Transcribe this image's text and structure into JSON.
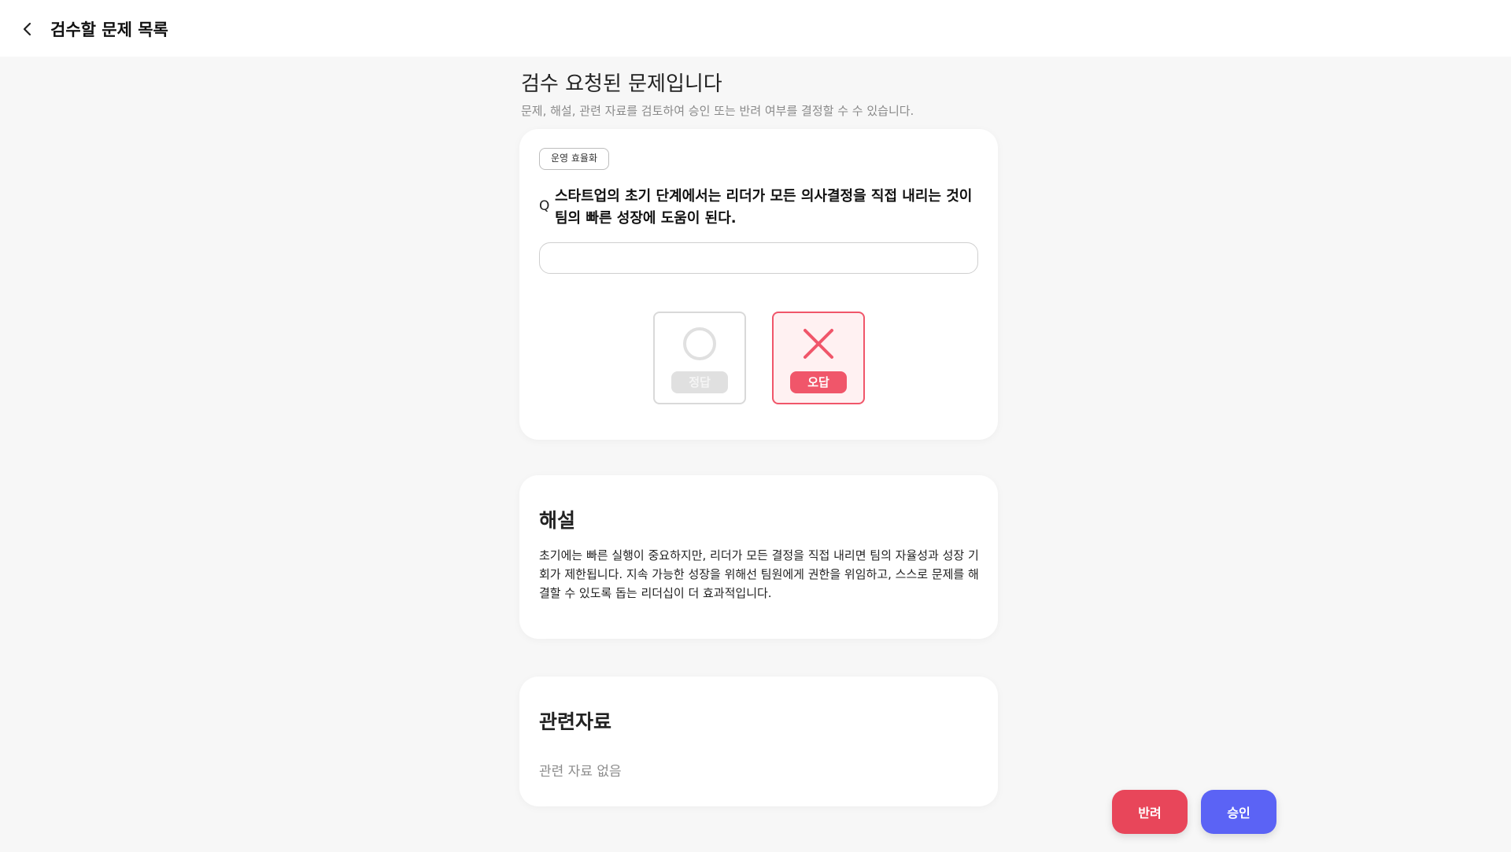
{
  "header": {
    "back_icon": "chevron-left-icon",
    "title": "검수할 문제 목록"
  },
  "page": {
    "heading": "검수 요청된 문제입니다",
    "subheading": "문제, 해설, 관련 자료를 검토하여 승인 또는 반려 여부를 결정할 수 수 있습니다."
  },
  "question": {
    "category": "운영 효율화",
    "q_mark": "Q",
    "text": "스타트업의 초기 단계에서는 리더가 모든 의사결정을 직접 내리는 것이 팀의 빠른 성장에 도움이 된다.",
    "answer_value": "",
    "choices": {
      "correct_label": "정답",
      "correct_icon": "circle-icon",
      "wrong_label": "오답",
      "wrong_icon": "x-icon",
      "selected": "오답"
    }
  },
  "explanation": {
    "title": "해설",
    "text": "초기에는 빠른 실행이 중요하지만, 리더가 모든 결정을 직접 내리면 팀의 자율성과 성장 기회가 제한됩니다. 지속 가능한 성장을 위해선 팀원에게 권한을 위임하고, 스스로 문제를 해결할 수 있도록 돕는 리더십이 더 효과적입니다."
  },
  "references": {
    "title": "관련자료",
    "empty_text": "관련 자료 없음"
  },
  "actions": {
    "reject_label": "반려",
    "approve_label": "승인"
  },
  "colors": {
    "reject": "#e8465a",
    "approve": "#5b63f5",
    "wrong_selected": "#f0566a"
  }
}
